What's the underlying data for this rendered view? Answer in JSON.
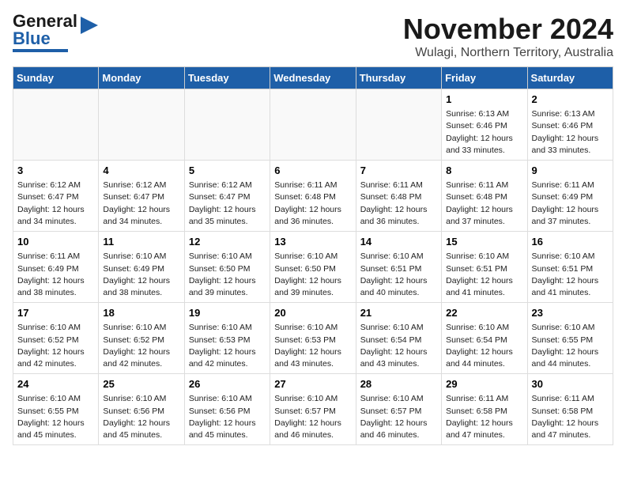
{
  "header": {
    "logo_general": "General",
    "logo_blue": "Blue",
    "month": "November 2024",
    "location": "Wulagi, Northern Territory, Australia"
  },
  "weekdays": [
    "Sunday",
    "Monday",
    "Tuesday",
    "Wednesday",
    "Thursday",
    "Friday",
    "Saturday"
  ],
  "weeks": [
    [
      {
        "day": "",
        "info": ""
      },
      {
        "day": "",
        "info": ""
      },
      {
        "day": "",
        "info": ""
      },
      {
        "day": "",
        "info": ""
      },
      {
        "day": "",
        "info": ""
      },
      {
        "day": "1",
        "info": "Sunrise: 6:13 AM\nSunset: 6:46 PM\nDaylight: 12 hours\nand 33 minutes."
      },
      {
        "day": "2",
        "info": "Sunrise: 6:13 AM\nSunset: 6:46 PM\nDaylight: 12 hours\nand 33 minutes."
      }
    ],
    [
      {
        "day": "3",
        "info": "Sunrise: 6:12 AM\nSunset: 6:47 PM\nDaylight: 12 hours\nand 34 minutes."
      },
      {
        "day": "4",
        "info": "Sunrise: 6:12 AM\nSunset: 6:47 PM\nDaylight: 12 hours\nand 34 minutes."
      },
      {
        "day": "5",
        "info": "Sunrise: 6:12 AM\nSunset: 6:47 PM\nDaylight: 12 hours\nand 35 minutes."
      },
      {
        "day": "6",
        "info": "Sunrise: 6:11 AM\nSunset: 6:48 PM\nDaylight: 12 hours\nand 36 minutes."
      },
      {
        "day": "7",
        "info": "Sunrise: 6:11 AM\nSunset: 6:48 PM\nDaylight: 12 hours\nand 36 minutes."
      },
      {
        "day": "8",
        "info": "Sunrise: 6:11 AM\nSunset: 6:48 PM\nDaylight: 12 hours\nand 37 minutes."
      },
      {
        "day": "9",
        "info": "Sunrise: 6:11 AM\nSunset: 6:49 PM\nDaylight: 12 hours\nand 37 minutes."
      }
    ],
    [
      {
        "day": "10",
        "info": "Sunrise: 6:11 AM\nSunset: 6:49 PM\nDaylight: 12 hours\nand 38 minutes."
      },
      {
        "day": "11",
        "info": "Sunrise: 6:10 AM\nSunset: 6:49 PM\nDaylight: 12 hours\nand 38 minutes."
      },
      {
        "day": "12",
        "info": "Sunrise: 6:10 AM\nSunset: 6:50 PM\nDaylight: 12 hours\nand 39 minutes."
      },
      {
        "day": "13",
        "info": "Sunrise: 6:10 AM\nSunset: 6:50 PM\nDaylight: 12 hours\nand 39 minutes."
      },
      {
        "day": "14",
        "info": "Sunrise: 6:10 AM\nSunset: 6:51 PM\nDaylight: 12 hours\nand 40 minutes."
      },
      {
        "day": "15",
        "info": "Sunrise: 6:10 AM\nSunset: 6:51 PM\nDaylight: 12 hours\nand 41 minutes."
      },
      {
        "day": "16",
        "info": "Sunrise: 6:10 AM\nSunset: 6:51 PM\nDaylight: 12 hours\nand 41 minutes."
      }
    ],
    [
      {
        "day": "17",
        "info": "Sunrise: 6:10 AM\nSunset: 6:52 PM\nDaylight: 12 hours\nand 42 minutes."
      },
      {
        "day": "18",
        "info": "Sunrise: 6:10 AM\nSunset: 6:52 PM\nDaylight: 12 hours\nand 42 minutes."
      },
      {
        "day": "19",
        "info": "Sunrise: 6:10 AM\nSunset: 6:53 PM\nDaylight: 12 hours\nand 42 minutes."
      },
      {
        "day": "20",
        "info": "Sunrise: 6:10 AM\nSunset: 6:53 PM\nDaylight: 12 hours\nand 43 minutes."
      },
      {
        "day": "21",
        "info": "Sunrise: 6:10 AM\nSunset: 6:54 PM\nDaylight: 12 hours\nand 43 minutes."
      },
      {
        "day": "22",
        "info": "Sunrise: 6:10 AM\nSunset: 6:54 PM\nDaylight: 12 hours\nand 44 minutes."
      },
      {
        "day": "23",
        "info": "Sunrise: 6:10 AM\nSunset: 6:55 PM\nDaylight: 12 hours\nand 44 minutes."
      }
    ],
    [
      {
        "day": "24",
        "info": "Sunrise: 6:10 AM\nSunset: 6:55 PM\nDaylight: 12 hours\nand 45 minutes."
      },
      {
        "day": "25",
        "info": "Sunrise: 6:10 AM\nSunset: 6:56 PM\nDaylight: 12 hours\nand 45 minutes."
      },
      {
        "day": "26",
        "info": "Sunrise: 6:10 AM\nSunset: 6:56 PM\nDaylight: 12 hours\nand 45 minutes."
      },
      {
        "day": "27",
        "info": "Sunrise: 6:10 AM\nSunset: 6:57 PM\nDaylight: 12 hours\nand 46 minutes."
      },
      {
        "day": "28",
        "info": "Sunrise: 6:10 AM\nSunset: 6:57 PM\nDaylight: 12 hours\nand 46 minutes."
      },
      {
        "day": "29",
        "info": "Sunrise: 6:11 AM\nSunset: 6:58 PM\nDaylight: 12 hours\nand 47 minutes."
      },
      {
        "day": "30",
        "info": "Sunrise: 6:11 AM\nSunset: 6:58 PM\nDaylight: 12 hours\nand 47 minutes."
      }
    ]
  ]
}
